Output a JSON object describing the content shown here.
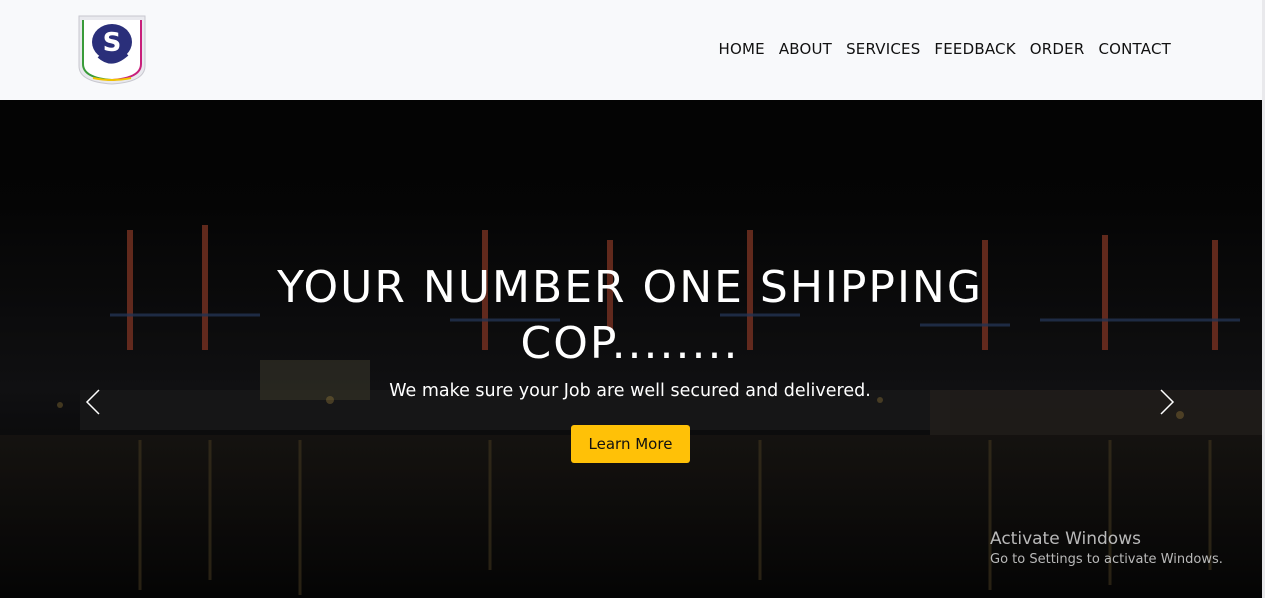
{
  "brand": {
    "logo_icon": "ss-shield-logo-icon"
  },
  "nav": {
    "items": [
      {
        "label": "HOME"
      },
      {
        "label": "ABOUT"
      },
      {
        "label": "SERVICES"
      },
      {
        "label": "FEEDBACK"
      },
      {
        "label": "ORDER"
      },
      {
        "label": "CONTACT"
      }
    ]
  },
  "hero": {
    "title": "YOUR NUMBER ONE SHIPPING COP........",
    "subtitle": "We make sure your Job are well secured and delivered.",
    "cta_label": "Learn More",
    "prev_icon": "chevron-left-icon",
    "next_icon": "chevron-right-icon",
    "background": "night-port-cranes-image"
  },
  "os_watermark": {
    "title": "Activate Windows",
    "subtitle": "Go to Settings to activate Windows."
  },
  "colors": {
    "nav_bg": "#f8f9fb",
    "cta_bg": "#ffc107",
    "hero_text": "#ffffff",
    "watermark": "#b9b9b9"
  }
}
